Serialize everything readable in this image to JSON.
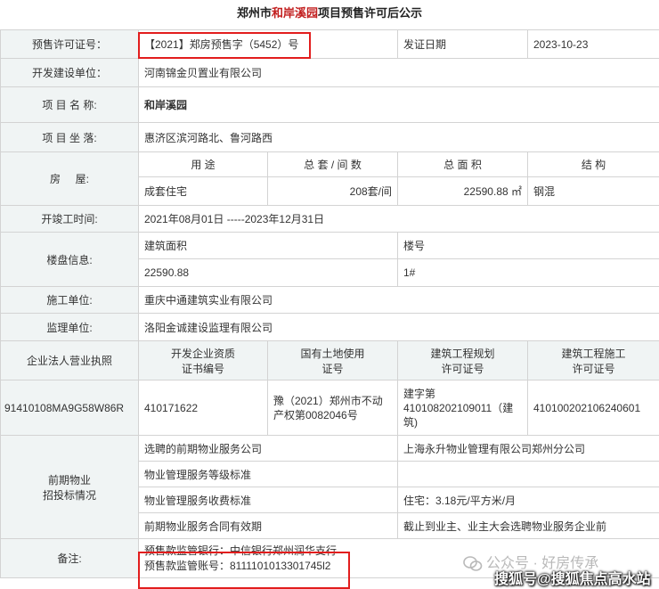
{
  "title": {
    "prefix": "郑州市",
    "highlight": "和岸溪园",
    "suffix": "项目预售许可后公示"
  },
  "rows": {
    "permit_no_label": "预售许可证号：",
    "permit_no_value": "【2021】郑房预售字（5452）号",
    "issue_date_label": "发证日期",
    "issue_date_value": "2023-10-23",
    "developer_label": "开发建设单位：",
    "developer_value": "河南锦金贝置业有限公司",
    "project_name_label": "项 目 名 称:",
    "project_name_value": "和岸溪园",
    "location_label": "项 目 坐 落:",
    "location_value": "惠济区滨河路北、鲁河路西",
    "house_label": "房     屋:",
    "house_headers": [
      "用 途",
      "总 套 / 间 数",
      "总 面 积",
      "结 构"
    ],
    "house_values": [
      "成套住宅",
      "208套/间",
      "22590.88 ㎡",
      "钢混"
    ],
    "construction_time_label": "开竣工时间:",
    "construction_time_value": "2021年08月01日 -----2023年12月31日",
    "building_info_label": "楼盘信息:",
    "building_area_label": "建筑面积",
    "building_no_label": "楼号",
    "building_area_value": "22590.88",
    "building_no_value": "1#",
    "builder_label": "施工单位:",
    "builder_value": "重庆中通建筑实业有限公司",
    "supervisor_label": "监理单位:",
    "supervisor_value": "洛阳金诚建设监理有限公司"
  },
  "licenses": {
    "headers": [
      "企业法人营业执照",
      "开发企业资质\n证书编号",
      "国有土地使用\n证号",
      "建筑工程规划\n许可证号",
      "建筑工程施工\n许可证号"
    ],
    "values": [
      "91410108MA9G58W86R",
      "410171622",
      "豫（2021）郑州市不动产权第0082046号",
      "建字第410108202109011（建筑)",
      "410100202106240601"
    ]
  },
  "property": {
    "label": "前期物业\n招投标情况",
    "items": [
      {
        "k": "选聘的前期物业服务公司",
        "v": "上海永升物业管理有限公司郑州分公司"
      },
      {
        "k": "物业管理服务等级标准",
        "v": ""
      },
      {
        "k": "物业管理服务收费标准",
        "v": "住宅：3.18元/平方米/月"
      },
      {
        "k": "前期物业服务合同有效期",
        "v": "截止到业主、业主大会选聘物业服务企业前"
      }
    ]
  },
  "remarks": {
    "label": "备注:",
    "line1": "预售款监管银行：中信银行郑州润华支行",
    "line2": "预售款监管账号：8111101013301745l2"
  },
  "watermarks": {
    "wechat": "公众号 · 好房传承",
    "sohu": "搜狐号@搜狐焦点高水站"
  },
  "colors": {
    "accent_red": "#c21f1f",
    "label_bg": "#f0f4f4",
    "border": "#d3d3d3"
  }
}
